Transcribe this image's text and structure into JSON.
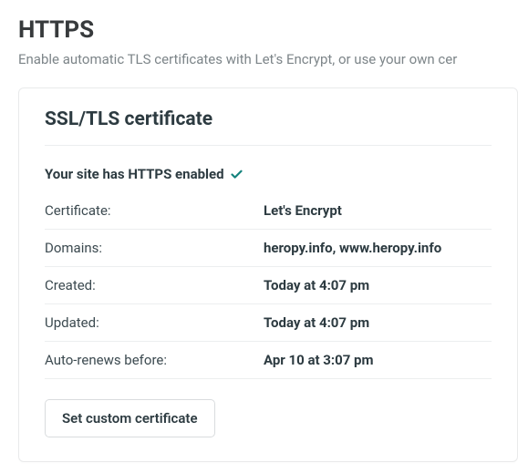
{
  "header": {
    "title": "HTTPS",
    "subtitle": "Enable automatic TLS certificates with Let's Encrypt, or use your own cer"
  },
  "card": {
    "title": "SSL/TLS certificate",
    "status_text": "Your site has HTTPS enabled",
    "status_icon": "check-icon",
    "rows": [
      {
        "label": "Certificate:",
        "value": "Let's Encrypt"
      },
      {
        "label": "Domains:",
        "value": "heropy.info, www.heropy.info"
      },
      {
        "label": "Created:",
        "value": "Today at 4:07 pm"
      },
      {
        "label": "Updated:",
        "value": "Today at 4:07 pm"
      },
      {
        "label": "Auto-renews before:",
        "value": "Apr 10 at 3:07 pm"
      }
    ],
    "actions": {
      "custom_cert_label": "Set custom certificate"
    }
  },
  "colors": {
    "accent": "#15837d",
    "text_muted": "#7d8589",
    "border": "#eceeef"
  }
}
